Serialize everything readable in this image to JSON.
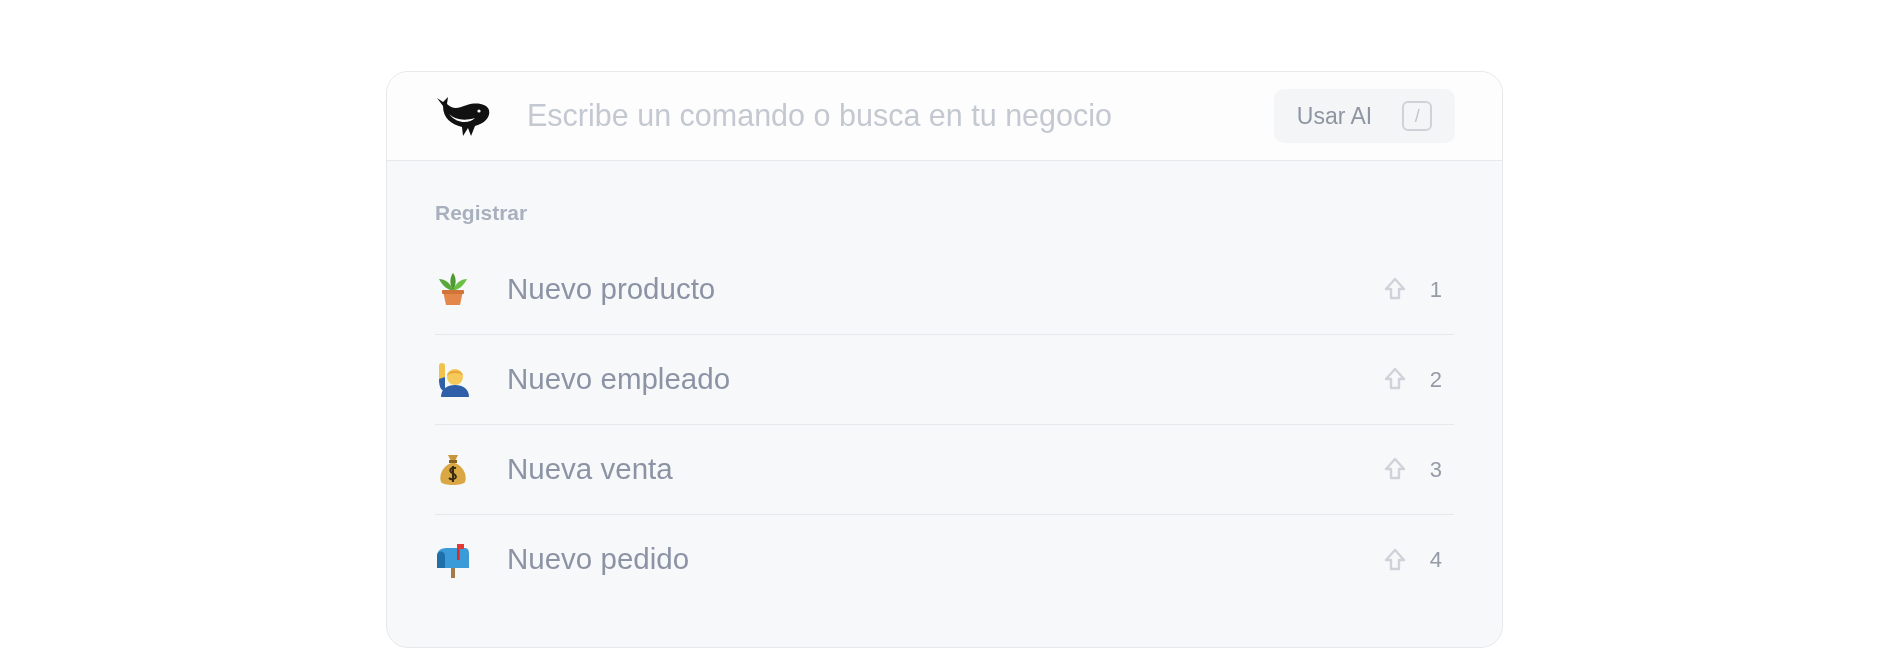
{
  "search": {
    "placeholder": "Escribe un comando o busca en tu negocio"
  },
  "ai_button": {
    "label": "Usar AI",
    "key": "/"
  },
  "section": {
    "title": "Registrar",
    "items": [
      {
        "kind": "plant",
        "label": "Nuevo producto",
        "shortcut": "1"
      },
      {
        "kind": "person",
        "label": "Nuevo empleado",
        "shortcut": "2"
      },
      {
        "kind": "moneybag",
        "label": "Nueva venta",
        "shortcut": "3"
      },
      {
        "kind": "mailbox",
        "label": "Nuevo pedido",
        "shortcut": "4"
      }
    ]
  }
}
